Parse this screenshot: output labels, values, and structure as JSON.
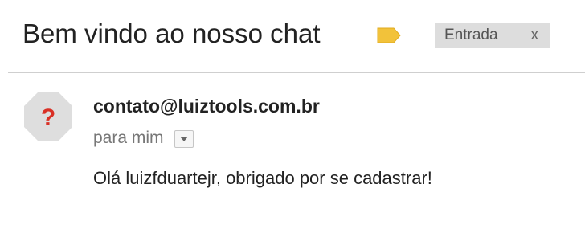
{
  "email": {
    "subject": "Bem vindo ao nosso chat",
    "label_icon": "label-tag-icon",
    "label_color": "#f2c23a",
    "inbox_chip": {
      "label": "Entrada",
      "close": "x"
    },
    "sender": "contato@luiztools.com.br",
    "avatar_icon": "unknown-sender-icon",
    "avatar_symbol": "?",
    "recipient": "para mim",
    "details_toggle_icon": "chevron-down-icon",
    "body": "Olá luizfduartejr, obrigado por se cadastrar!"
  },
  "colors": {
    "avatar_bg": "#dedede",
    "avatar_symbol": "#d93025",
    "chip_bg": "#dddddd"
  }
}
